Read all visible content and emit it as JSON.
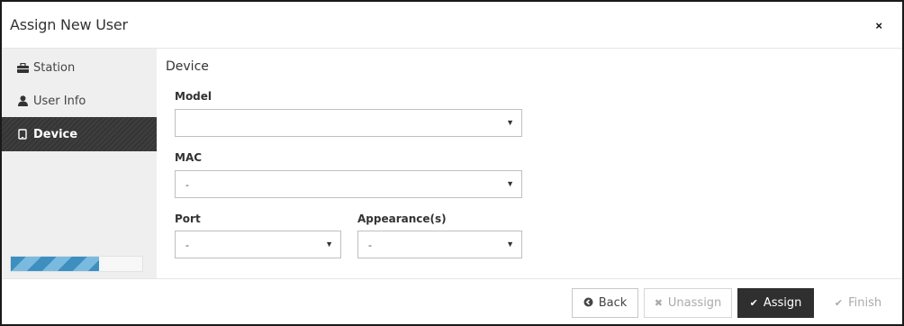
{
  "dialog": {
    "title": "Assign New User",
    "close_icon": "×"
  },
  "sidebar": {
    "items": [
      {
        "label": "Station",
        "icon": "briefcase-icon",
        "active": false
      },
      {
        "label": "User Info",
        "icon": "user-icon",
        "active": false
      },
      {
        "label": "Device",
        "icon": "tablet-icon",
        "active": true
      }
    ],
    "progress_fraction": 0.67,
    "colors": {
      "progress_dark": "#3d8fc0",
      "progress_light": "#7bbadf",
      "active_bg": "#3a3a3a"
    }
  },
  "main": {
    "section_title": "Device",
    "fields": {
      "model": {
        "label": "Model",
        "value": ""
      },
      "mac": {
        "label": "MAC",
        "value": "-"
      },
      "port": {
        "label": "Port",
        "value": "-"
      },
      "appearance": {
        "label": "Appearance(s)",
        "value": "-"
      }
    }
  },
  "footer": {
    "back_label": "Back",
    "unassign_label": "Unassign",
    "assign_label": "Assign",
    "finish_label": "Finish"
  }
}
